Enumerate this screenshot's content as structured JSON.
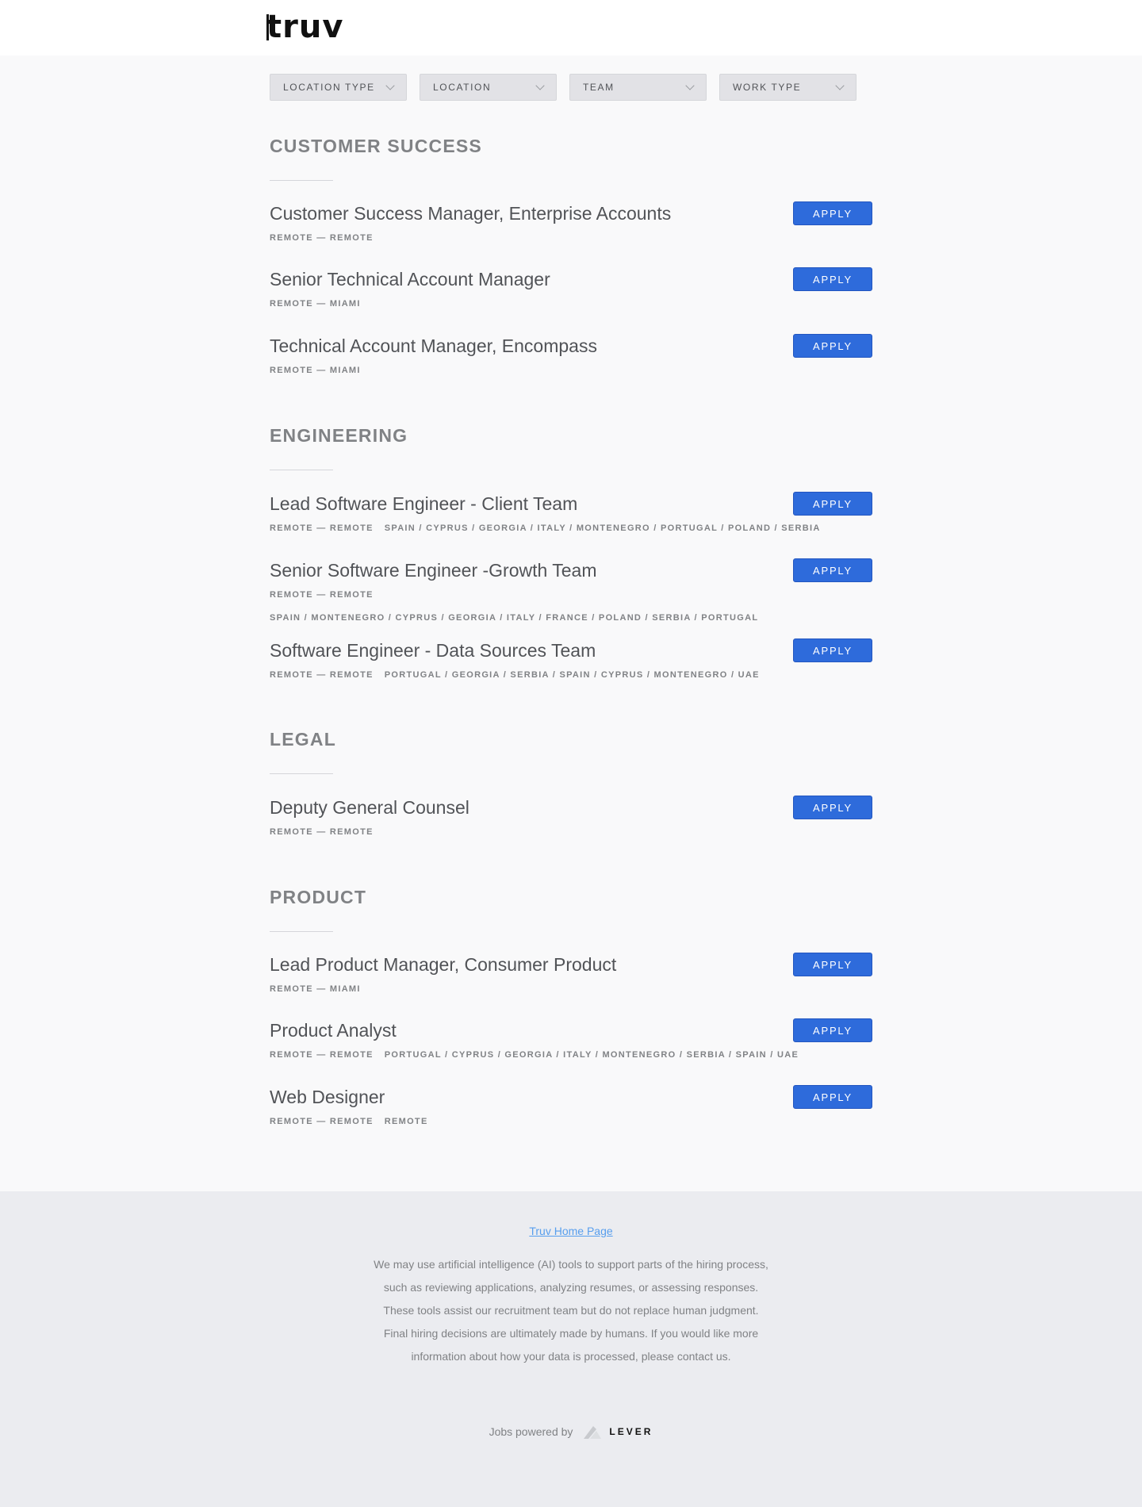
{
  "header": {
    "logo_text": "truv"
  },
  "filters": [
    {
      "label": "LOCATION TYPE"
    },
    {
      "label": "LOCATION"
    },
    {
      "label": "TEAM"
    },
    {
      "label": "WORK TYPE"
    }
  ],
  "apply_label": "APPLY",
  "groups": [
    {
      "title": "CUSTOMER SUCCESS",
      "postings": [
        {
          "title": "Customer Success Manager, Enterprise Accounts",
          "meta": "REMOTE — REMOTE",
          "locations": ""
        },
        {
          "title": "Senior Technical Account Manager",
          "meta": "REMOTE — MIAMI",
          "locations": ""
        },
        {
          "title": "Technical Account Manager, Encompass",
          "meta": "REMOTE — MIAMI",
          "locations": ""
        }
      ]
    },
    {
      "title": "ENGINEERING",
      "postings": [
        {
          "title": "Lead Software Engineer - Client Team",
          "meta": "REMOTE — REMOTE",
          "locations": "SPAIN / CYPRUS / GEORGIA / ITALY / MONTENEGRO / PORTUGAL / POLAND / SERBIA"
        },
        {
          "title": "Senior Software Engineer -Growth Team",
          "meta": "REMOTE — REMOTE",
          "locations": "SPAIN / MONTENEGRO / CYPRUS / GEORGIA / ITALY / FRANCE / POLAND / SERBIA / PORTUGAL"
        },
        {
          "title": "Software Engineer - Data Sources Team",
          "meta": "REMOTE — REMOTE",
          "locations": "PORTUGAL / GEORGIA / SERBIA / SPAIN / CYPRUS / MONTENEGRO / UAE"
        }
      ]
    },
    {
      "title": "LEGAL",
      "postings": [
        {
          "title": "Deputy General Counsel",
          "meta": "REMOTE — REMOTE",
          "locations": ""
        }
      ]
    },
    {
      "title": "PRODUCT",
      "postings": [
        {
          "title": "Lead Product Manager, Consumer Product",
          "meta": "REMOTE — MIAMI",
          "locations": ""
        },
        {
          "title": "Product Analyst",
          "meta": "REMOTE — REMOTE",
          "locations": "PORTUGAL / CYPRUS / GEORGIA / ITALY / MONTENEGRO / SERBIA / SPAIN / UAE"
        },
        {
          "title": "Web Designer",
          "meta": "REMOTE — REMOTE",
          "locations": "REMOTE"
        }
      ]
    }
  ],
  "footer": {
    "home_link": "Truv Home Page",
    "disclaimer": "We may use artificial intelligence (AI) tools to support parts of the hiring process, such as reviewing applications, analyzing resumes, or assessing responses. These tools assist our recruitment team but do not replace human judgment. Final hiring decisions are ultimately made by humans. If you would like more information about how your data is processed, please contact us.",
    "powered_by": "Jobs powered by",
    "lever_name": "LEVER"
  },
  "colors": {
    "accent": "#2e6bdb",
    "link": "#579eee",
    "page_bg": "#f9f9fa",
    "footer_bg": "#ebecf0"
  }
}
